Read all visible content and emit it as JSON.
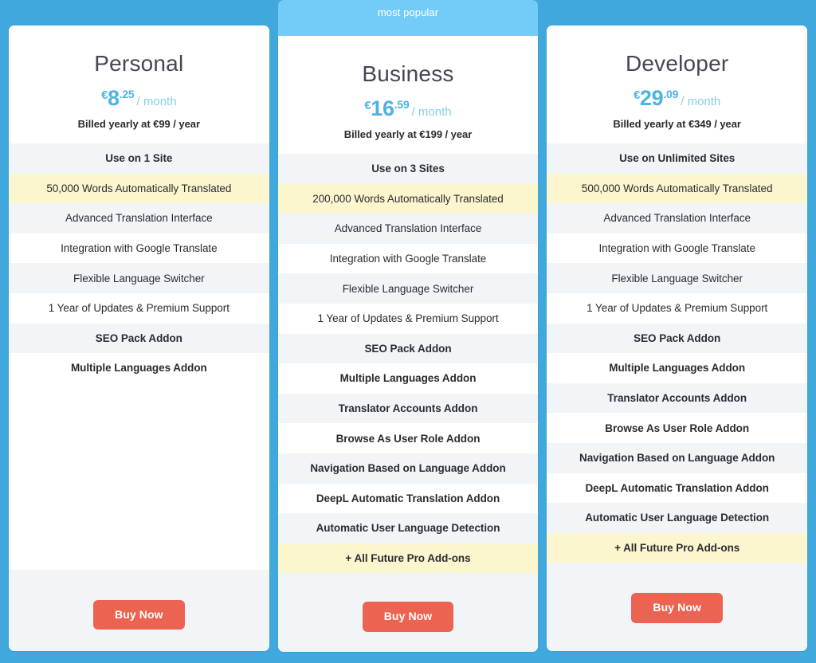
{
  "page": {
    "background_color": "#41a8dd",
    "accent_color": "#4cb3e4",
    "button_color": "#ed6352",
    "highlight_row_color": "#fcf6cf",
    "alt_row_color": "#f1f5f8",
    "title_color": "#464657"
  },
  "plans": [
    {
      "id": "personal",
      "name": "Personal",
      "badge": "",
      "currency": "€",
      "amount": "8",
      "cents": ".25",
      "period": "/ month",
      "billed_note": "Billed yearly at €99 / year",
      "sites_label": "Use on 1 Site",
      "features": [
        "50,000 Words Automatically Translated",
        "Advanced Translation Interface",
        "Integration with Google Translate",
        "Flexible Language Switcher",
        "1 Year of Updates & Premium Support",
        "SEO Pack Addon",
        "Multiple Languages Addon"
      ],
      "cta_label": "Buy Now"
    },
    {
      "id": "business",
      "name": "Business",
      "badge": "most popular",
      "currency": "€",
      "amount": "16",
      "cents": ".59",
      "period": "/ month",
      "billed_note": "Billed yearly at €199 / year",
      "sites_label": "Use on 3 Sites",
      "features": [
        "200,000 Words Automatically Translated",
        "Advanced Translation Interface",
        "Integration with Google Translate",
        "Flexible Language Switcher",
        "1 Year of Updates & Premium Support",
        "SEO Pack Addon",
        "Multiple Languages Addon",
        "Translator Accounts Addon",
        "Browse As User Role Addon",
        "Navigation Based on Language Addon",
        "DeepL Automatic Translation Addon",
        "Automatic User Language Detection",
        "+ All Future Pro Add-ons"
      ],
      "cta_label": "Buy Now"
    },
    {
      "id": "developer",
      "name": "Developer",
      "badge": "",
      "currency": "€",
      "amount": "29",
      "cents": ".09",
      "period": "/ month",
      "billed_note": "Billed yearly at €349 / year",
      "sites_label": "Use on Unlimited Sites",
      "features": [
        "500,000 Words Automatically Translated",
        "Advanced Translation Interface",
        "Integration with Google Translate",
        "Flexible Language Switcher",
        "1 Year of Updates & Premium Support",
        "SEO Pack Addon",
        "Multiple Languages Addon",
        "Translator Accounts Addon",
        "Browse As User Role Addon",
        "Navigation Based on Language Addon",
        "DeepL Automatic Translation Addon",
        "Automatic User Language Detection",
        "+ All Future Pro Add-ons"
      ],
      "cta_label": "Buy Now"
    }
  ]
}
